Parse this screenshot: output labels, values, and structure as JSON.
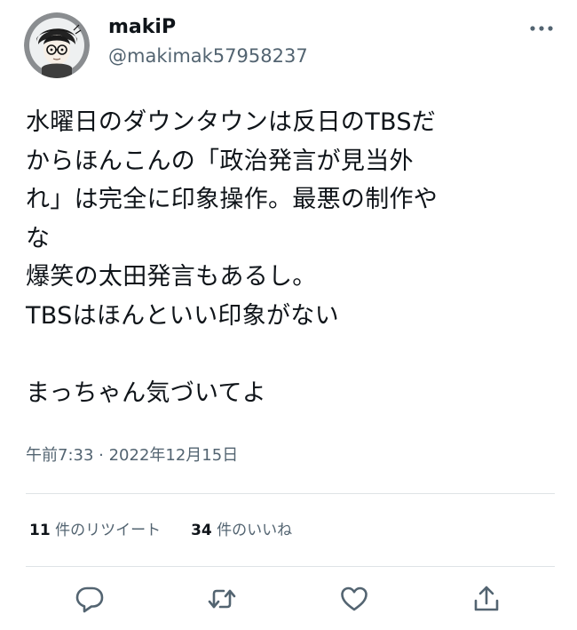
{
  "author": {
    "display_name": "makiP",
    "handle": "@makimak57958237",
    "avatar_icon": "avatar-illustration-icon"
  },
  "tweet": {
    "text": "水曜日のダウンタウンは反日のTBSだ\nからほんこんの「政治発言が見当外\nれ」は完全に印象操作。最悪の制作や\nな\n爆笑の太田発言もあるし。\nTBSはほんといい印象がない\n\nまっちゃん気づいてよ",
    "timestamp": "午前7:33 · 2022年12月15日"
  },
  "stats": {
    "retweets_count": "11",
    "retweets_label": " 件のリツイート",
    "likes_count": "34",
    "likes_label": " 件のいいね"
  },
  "actions": [
    {
      "icon": "reply-icon"
    },
    {
      "icon": "retweet-icon"
    },
    {
      "icon": "like-heart-icon"
    },
    {
      "icon": "share-icon"
    }
  ],
  "colors": {
    "text_primary": "#0f1419",
    "text_secondary": "#536471",
    "divider": "#dfe3e6"
  }
}
